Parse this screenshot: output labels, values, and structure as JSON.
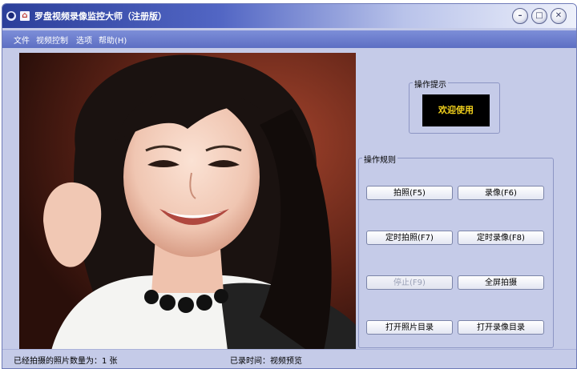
{
  "window": {
    "title": "罗盘视频录像监控大师（注册版）",
    "caption_buttons": {
      "minimize": "–",
      "maximize": "□",
      "close": "✕"
    }
  },
  "menu": {
    "items": [
      {
        "label": "文件"
      },
      {
        "label": "视频控制"
      },
      {
        "label": "选项"
      },
      {
        "label": "帮助(H)"
      }
    ]
  },
  "hint_panel": {
    "legend": "操作提示",
    "message": "欢迎使用"
  },
  "control_panel": {
    "legend": "操作规则",
    "buttons": {
      "capture": "拍照(F5)",
      "record": "录像(F6)",
      "timed_capture": "定时拍照(F7)",
      "timed_record": "定时录像(F8)",
      "stop": "停止(F9)",
      "fullscreen": "全屏拍摄",
      "open_photo_dir": "打开照片目录",
      "open_video_dir": "打开录像目录"
    }
  },
  "status": {
    "photo_count": "已经拍摄的照片数量为：1 张",
    "record_time": "已录时间：视频预览"
  },
  "icons": {
    "system_menu": "system-menu-icon",
    "app": "app-icon"
  }
}
